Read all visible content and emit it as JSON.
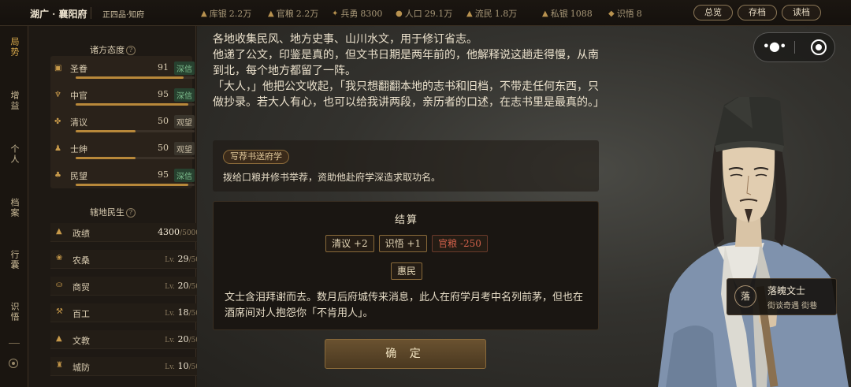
{
  "topbar": {
    "region": "湖广 · 襄阳府",
    "rank": "正四品·知府",
    "stats": [
      {
        "icon": "silver-icon",
        "label": "库银",
        "value": "2.2万"
      },
      {
        "icon": "grain-icon",
        "label": "官粮",
        "value": "2.2万"
      },
      {
        "icon": "soldier-icon",
        "label": "兵勇",
        "value": "8300"
      },
      {
        "icon": "population-icon",
        "label": "人口",
        "value": "29.1万"
      },
      {
        "icon": "refugee-icon",
        "label": "流民",
        "value": "1.8万"
      },
      {
        "icon": "private-silver-icon",
        "label": "私银",
        "value": "1088"
      },
      {
        "icon": "insight-icon",
        "label": "识悟",
        "value": "8"
      }
    ],
    "buttons": {
      "overview": "总览",
      "save": "存档",
      "load": "读档"
    }
  },
  "nav": [
    {
      "label": "局势",
      "active": true
    },
    {
      "label": "增益",
      "active": false
    },
    {
      "label": "个人",
      "active": false
    },
    {
      "label": "档案",
      "active": false
    },
    {
      "label": "行囊",
      "active": false
    },
    {
      "label": "识悟",
      "active": false
    }
  ],
  "attitudes": {
    "title": "诸方态度",
    "help": "?",
    "items": [
      {
        "icon": "emperor-icon",
        "name": "圣眷",
        "value": "91",
        "tag": "深信",
        "tag_type": "deep",
        "level": 0.91
      },
      {
        "icon": "palace-icon",
        "name": "中官",
        "value": "95",
        "tag": "深信",
        "tag_type": "deep",
        "level": 0.95
      },
      {
        "icon": "scholar-opinion-icon",
        "name": "清议",
        "value": "50",
        "tag": "观望",
        "tag_type": "watch",
        "level": 0.5
      },
      {
        "icon": "gentry-icon",
        "name": "士绅",
        "value": "50",
        "tag": "观望",
        "tag_type": "watch",
        "level": 0.5
      },
      {
        "icon": "people-icon",
        "name": "民望",
        "value": "95",
        "tag": "深信",
        "tag_type": "deep",
        "level": 0.95
      }
    ]
  },
  "livelihood": {
    "title": "辖地民生",
    "help": "?",
    "items": [
      {
        "icon": "merit-icon",
        "name": "政绩",
        "lv": "",
        "value": "4300",
        "max": "/5000"
      },
      {
        "icon": "farming-icon",
        "name": "农桑",
        "lv": "Lv.",
        "value": "29",
        "max": "/50"
      },
      {
        "icon": "trade-icon",
        "name": "商贸",
        "lv": "Lv.",
        "value": "20",
        "max": "/50"
      },
      {
        "icon": "craft-icon",
        "name": "百工",
        "lv": "Lv.",
        "value": "18",
        "max": "/50"
      },
      {
        "icon": "education-icon",
        "name": "文教",
        "lv": "Lv.",
        "value": "20",
        "max": "/50"
      },
      {
        "icon": "defense-icon",
        "name": "城防",
        "lv": "Lv.",
        "value": "10",
        "max": "/50"
      }
    ]
  },
  "story": {
    "text": "各地收集民风、地方史事、山川水文，用于修订省志。\n他递了公文，印鉴是真的，但文书日期是两年前的，他解释说这趟走得慢，从南到北，每个地方都留了一阵。\n「大人，」他把公文收起，「我只想翻翻本地的志书和旧档，不带走任何东西，只做抄录。若大人有心，也可以给我讲两段，亲历者的口述，在志书里是最真的。」"
  },
  "choice": {
    "tag": "写荐书送府学",
    "text": "拨给口粮并修书举荐，资助他赴府学深造求取功名。"
  },
  "result": {
    "title": "结算",
    "effects": [
      {
        "text": "清议 +2",
        "negative": false
      },
      {
        "text": "识悟 +1",
        "negative": false
      },
      {
        "text": "官粮 -250",
        "negative": true
      }
    ],
    "extra": "惠民",
    "text": "文士含泪拜谢而去。数月后府城传来消息，此人在府学月考中名列前茅，但也在酒席间对人抱怨你「不肯用人」。"
  },
  "confirm": "确 定",
  "capsule": {
    "more": "•●•"
  },
  "npc": {
    "badge": "落",
    "name": "落魄文士",
    "sub": "街谈奇遇  街巷"
  }
}
